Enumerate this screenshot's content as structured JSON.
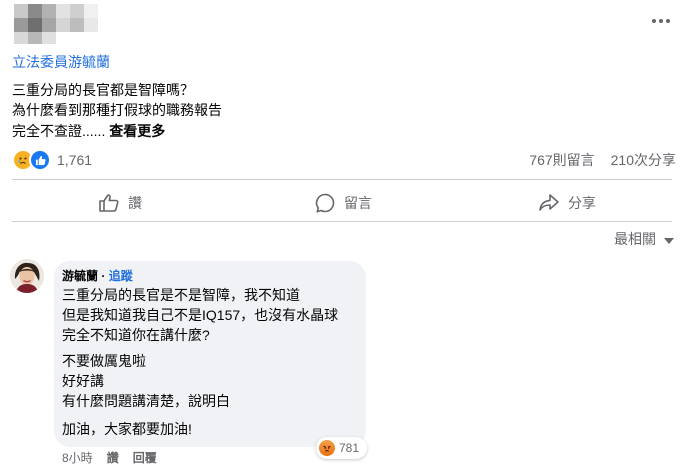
{
  "post": {
    "author": "立法委員游毓蘭",
    "lines": [
      "三重分局的長官都是智障嗎？",
      "為什麼看到那種打假球的職務報告",
      "完全不查證......"
    ],
    "see_more": "查看更多"
  },
  "reactions": {
    "count": "1,761",
    "icons": [
      "sad-icon",
      "like-icon"
    ]
  },
  "stats": {
    "comments": "767則留言",
    "shares": "210次分享"
  },
  "actions": {
    "like": "讚",
    "comment": "留言",
    "share": "分享"
  },
  "sort": {
    "label": "最相關"
  },
  "comment": {
    "author": "游毓蘭",
    "separator": " · ",
    "follow": "追蹤",
    "lines": [
      "三重分局的長官是不是智障，我不知道",
      "但是我知道我自己不是IQ157，也沒有水晶球",
      "完全不知道你在講什麼?",
      "不要做厲鬼啦",
      "好好講",
      "有什麼問題講清楚，說明白",
      "加油，大家都要加油!"
    ],
    "reaction_count": "781",
    "reaction_icon": "angry-icon",
    "time": "8小時",
    "like": "讚",
    "reply": "回覆"
  },
  "colors": {
    "link": "#216fdb",
    "muted": "#65676b",
    "bubble": "#f0f2f5",
    "like": "#1877f2",
    "sad": "#f7b125",
    "angry": "#e9710f"
  }
}
